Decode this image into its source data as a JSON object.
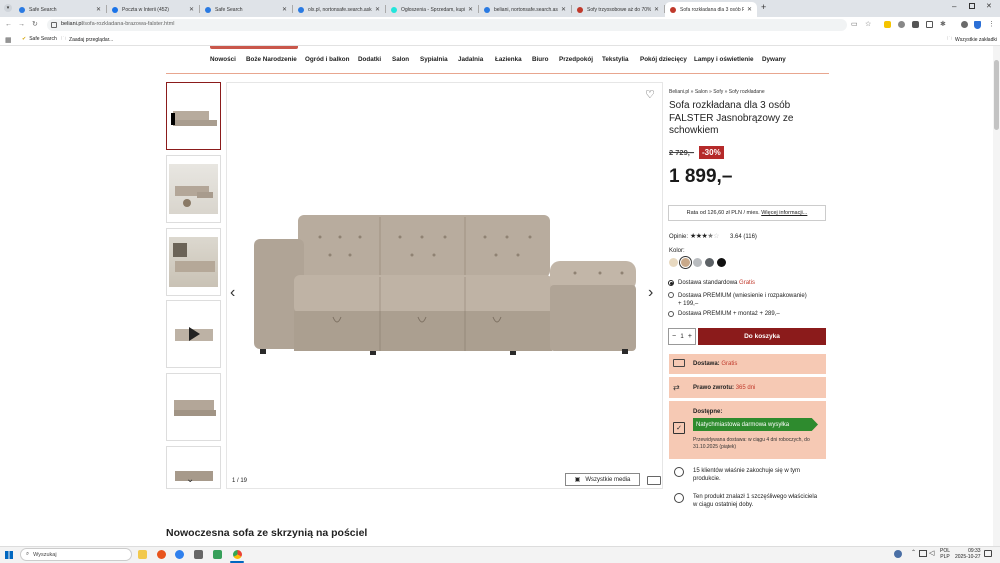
{
  "browser": {
    "tabs": [
      {
        "title": "Safe Search",
        "color": "#2a7ae2"
      },
      {
        "title": "Poczta w Interii (452)",
        "color": "#1a73e8"
      },
      {
        "title": "Safe Search",
        "color": "#2a7ae2"
      },
      {
        "title": "olx.pl, nortonsafe.search.ask.co",
        "color": "#2a7ae2"
      },
      {
        "title": "Ogłoszenia - Sprzedam, kupię",
        "color": "#23e5db"
      },
      {
        "title": "beliani, nortonsafe.search.ask.c",
        "color": "#2a7ae2"
      },
      {
        "title": "Sofy trzyosobowe aż do 70% ta",
        "color": "#c0392b"
      },
      {
        "title": "Sofa rozkładana dla 3 osób F",
        "color": "#c0392b"
      }
    ],
    "url_domain": "beliani.pl",
    "url_path": "/sofa-rozkladana-brazowa-falster.html",
    "bookmarks": [
      "Safe Search",
      "Zaadaj przeglądar..."
    ],
    "all_bookmarks": "Wszystkie zakładki"
  },
  "nav": [
    "Nowości",
    "Boże Narodzenie",
    "Ogród i balkon",
    "Dodatki",
    "Salon",
    "Sypialnia",
    "Jadalnia",
    "Łazienka",
    "Biuro",
    "Przedpokój",
    "Tekstylia",
    "Pokój dziecięcy",
    "Lampy i oświetlenie",
    "Dywany"
  ],
  "gallery": {
    "counter": "1 / 19",
    "media_button": "Wszystkie media"
  },
  "product": {
    "breadcrumb": "Beliani.pl » Salon » Sofy » Sofy rozkładane",
    "title_lines": [
      "Sofa rozkładana dla 3 osób",
      "FALSTER Jasnobrązowy ze",
      "schowkiem"
    ],
    "old_price": "2 729,–",
    "discount": "-30%",
    "price": "1 899,–",
    "installment": "Rata od 126,60 zł PLN / mies.",
    "installment_link": "Więcej informacji...",
    "rating_label": "Opinie:",
    "rating_value": 3.64,
    "rating_text": "3.64 (116)",
    "color_label": "Kolor:",
    "swatches": [
      "#e8d9c0",
      "#c9a98a",
      "#b9bcbf",
      "#5d6266",
      "#111111"
    ],
    "delivery": [
      {
        "label": "Dostawa standardowa",
        "extra": "Gratis"
      },
      {
        "label": "Dostawa PREMIUM (wniesienie i rozpakowanie)",
        "extra": "+ 199,–"
      },
      {
        "label": "Dostawa PREMIUM + montaż + 289,–",
        "extra": ""
      }
    ],
    "quantity": "1",
    "add_to_cart": "Do koszyka",
    "shipping_label": "Dostawa:",
    "shipping_value": "Gratis",
    "return_label": "Prawo zwrotu:",
    "return_value": "365 dni",
    "availability_label": "Dostępne:",
    "availability_banner": "Natychmiastowa darmowa wysyłka",
    "delivery_estimate": "Przewidywana dostawa: w ciągu 4 dni roboczych, do",
    "delivery_date": "31.10.2025 (piątek)",
    "social1_line1": "15 klientów właśnie zakochuje się w tym",
    "social1_line2": "produkcie.",
    "social2_line1": "Ten produkt znalazł 1 szczęśliwego właściciela",
    "social2_line2": "w ciągu ostatniej doby.",
    "section_heading": "Nowoczesna sofa ze skrzynią na pościel"
  },
  "taskbar": {
    "search_placeholder": "Wyszukaj",
    "lang1": "POL",
    "lang2": "PLP",
    "time": "09:33",
    "date": "2025-10-27"
  },
  "colors": {
    "brand": "#8b1b1b",
    "discount": "#b52a2a",
    "pink": "#f6c9b4",
    "green": "#2e8b2e"
  }
}
